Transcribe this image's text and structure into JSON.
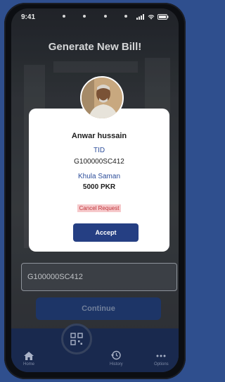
{
  "status_bar": {
    "time": "9:41"
  },
  "screen": {
    "title": "Generate New Bill!"
  },
  "form": {
    "tid_value": "G100000SC412",
    "continue_label": "Continue"
  },
  "modal": {
    "name": "Anwar hussain",
    "tid_label": "TID",
    "tid_value": "G100000SC412",
    "item": "Khula Saman",
    "amount": "5000 PKR",
    "cancel_label": "Cancel Request",
    "accept_label": "Accept"
  },
  "nav": {
    "items": [
      {
        "label": "Home",
        "icon": "home-icon"
      },
      {
        "label": "",
        "icon": "qr-scan-icon"
      },
      {
        "label": "History",
        "icon": "history-icon"
      },
      {
        "label": "Options",
        "icon": "more-icon"
      }
    ]
  },
  "colors": {
    "primary": "#253f83",
    "nav_bg": "#1c2d55",
    "cancel_bg": "#f6c9cb",
    "cancel_text": "#c0373d",
    "label_blue": "#2c4d9a",
    "page_bg": "#2f4f8e"
  }
}
